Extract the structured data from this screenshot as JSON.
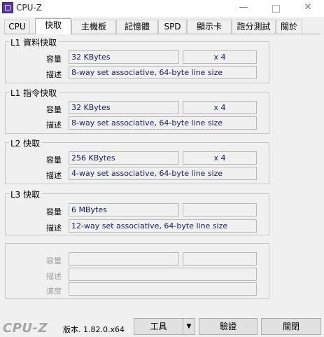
{
  "window": {
    "title": "CPU-Z",
    "minimize": "—",
    "close": "✕"
  },
  "tabs": [
    {
      "label": "CPU",
      "active": false
    },
    {
      "label": "快取",
      "active": true
    },
    {
      "label": "主機板",
      "active": false
    },
    {
      "label": "記憶體",
      "active": false
    },
    {
      "label": "SPD",
      "active": false
    },
    {
      "label": "顯示卡",
      "active": false
    },
    {
      "label": "跑分測試",
      "active": false
    },
    {
      "label": "關於",
      "active": false
    }
  ],
  "l1_data": {
    "title": "L1 資料快取",
    "size_label": "容量",
    "size": "32 KBytes",
    "count": "x 4",
    "desc_label": "描述",
    "desc": "8-way set associative, 64-byte line size"
  },
  "l1_inst": {
    "title": "L1 指令快取",
    "size_label": "容量",
    "size": "32 KBytes",
    "count": "x 4",
    "desc_label": "描述",
    "desc": "8-way set associative, 64-byte line size"
  },
  "l2": {
    "title": "L2 快取",
    "size_label": "容量",
    "size": "256 KBytes",
    "count": "x 4",
    "desc_label": "描述",
    "desc": "4-way set associative, 64-byte line size"
  },
  "l3": {
    "title": "L3 快取",
    "size_label": "容量",
    "size": "6 MBytes",
    "count": "",
    "desc_label": "描述",
    "desc": "12-way set associative, 64-byte line size"
  },
  "extra": {
    "size_label": "容量",
    "desc_label": "描述",
    "speed_label": "速度"
  },
  "footer": {
    "brand": "CPU-Z",
    "version": "版本. 1.82.0.x64",
    "tools": "工具",
    "tools_arrow": "▼",
    "validate": "驗證",
    "close": "關閉"
  }
}
